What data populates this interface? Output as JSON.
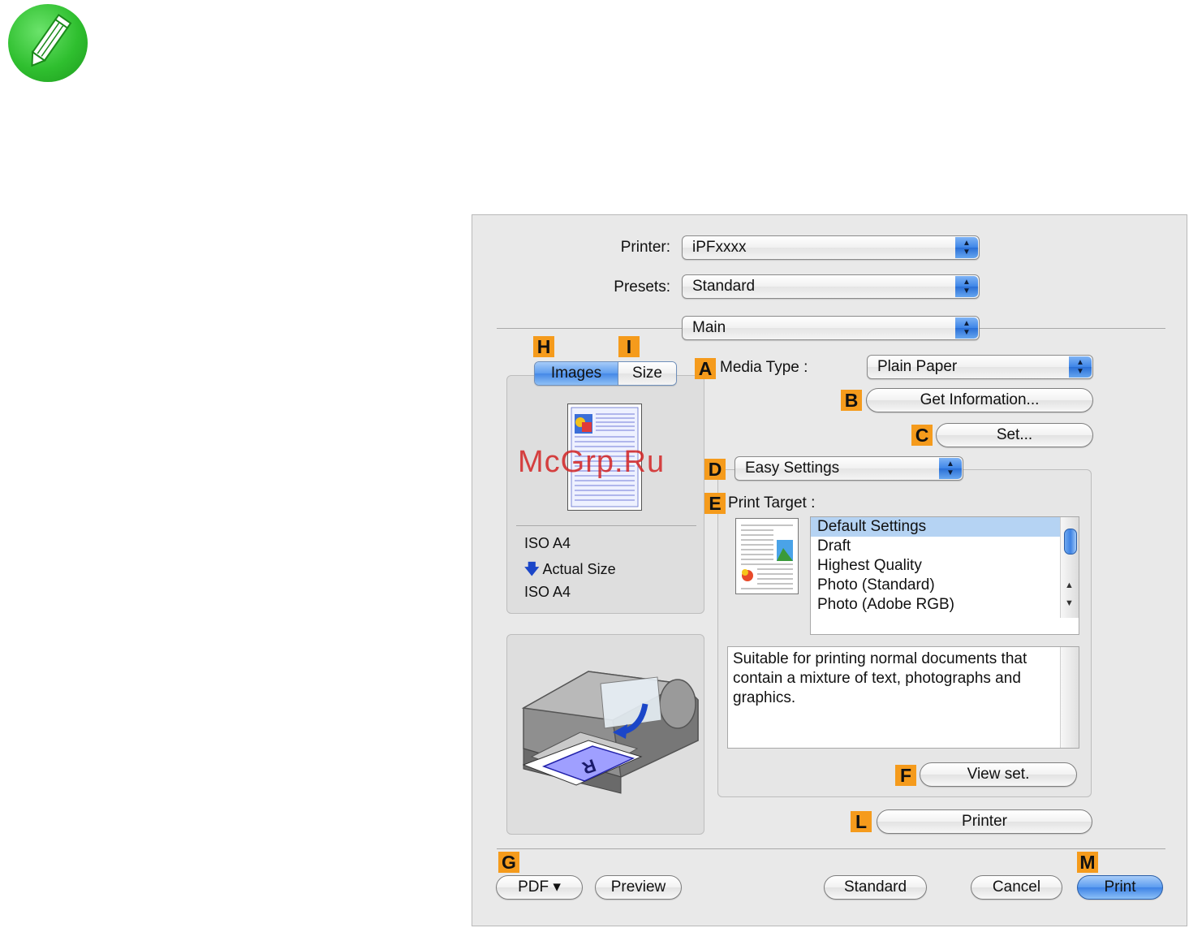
{
  "dialog": {
    "printer_label": "Printer:",
    "printer_value": "iPFxxxx",
    "presets_label": "Presets:",
    "presets_value": "Standard",
    "pane_value": "Main"
  },
  "tabs": {
    "images": "Images",
    "size": "Size"
  },
  "preview": {
    "paper_size_top": "ISO A4",
    "scale": "Actual Size",
    "paper_size_bottom": "ISO A4"
  },
  "media": {
    "label": "Media Type :",
    "value": "Plain Paper",
    "get_information": "Get Information...",
    "set": "Set..."
  },
  "settings_mode": "Easy Settings",
  "print_target": {
    "label": "Print Target :",
    "items": [
      "Default Settings",
      "Draft",
      "Highest Quality",
      "Photo (Standard)",
      "Photo (Adobe RGB)"
    ],
    "selected": "Default Settings",
    "description": "Suitable for printing normal documents that contain a mixture of text, photographs and graphics.",
    "view_set": "View set."
  },
  "printer_button": "Printer",
  "footer": {
    "pdf": "PDF ▾",
    "preview": "Preview",
    "standard": "Standard",
    "cancel": "Cancel",
    "print": "Print"
  },
  "callouts": {
    "A": "A",
    "B": "B",
    "C": "C",
    "D": "D",
    "E": "E",
    "F": "F",
    "G": "G",
    "H": "H",
    "I": "I",
    "L": "L",
    "M": "M"
  },
  "watermark": "McGrp.Ru",
  "colors": {
    "callout": "#f59b1c",
    "accent_blue": "#3d85e8",
    "note_green": "#2fbf2f"
  },
  "icons": {
    "note": "pencil-note-icon",
    "popup": "up-down-arrows-icon",
    "scale": "down-arrow-icon"
  }
}
